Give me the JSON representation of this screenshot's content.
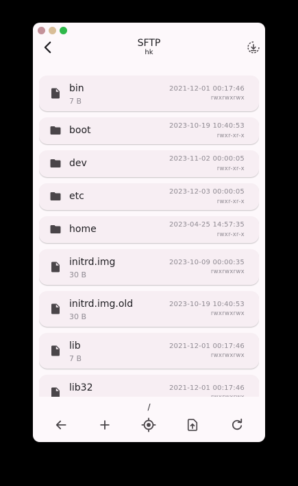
{
  "header": {
    "title": "SFTP",
    "subtitle": "hk"
  },
  "items": [
    {
      "type": "file",
      "name": "bin",
      "size": "7 B",
      "date": "2021-12-01 00:17:46",
      "perm": "rwxrwxrwx"
    },
    {
      "type": "folder",
      "name": "boot",
      "size": "",
      "date": "2023-10-19 10:40:53",
      "perm": "rwxr-xr-x"
    },
    {
      "type": "folder",
      "name": "dev",
      "size": "",
      "date": "2023-11-02 00:00:05",
      "perm": "rwxr-xr-x"
    },
    {
      "type": "folder",
      "name": "etc",
      "size": "",
      "date": "2023-12-03 00:00:05",
      "perm": "rwxr-xr-x"
    },
    {
      "type": "folder",
      "name": "home",
      "size": "",
      "date": "2023-04-25 14:57:35",
      "perm": "rwxr-xr-x"
    },
    {
      "type": "file",
      "name": "initrd.img",
      "size": "30 B",
      "date": "2023-10-09 00:00:35",
      "perm": "rwxrwxrwx"
    },
    {
      "type": "file",
      "name": "initrd.img.old",
      "size": "30 B",
      "date": "2023-10-19 10:40:53",
      "perm": "rwxrwxrwx"
    },
    {
      "type": "file",
      "name": "lib",
      "size": "7 B",
      "date": "2021-12-01 00:17:46",
      "perm": "rwxrwxrwx"
    },
    {
      "type": "file",
      "name": "lib32",
      "size": "",
      "date": "2021-12-01 00:17:46",
      "perm": "rwxrwxrwx"
    }
  ],
  "footer": {
    "path": "/"
  },
  "icons": {
    "back": "chevron-left-icon",
    "download": "download-circle-icon",
    "file": "file-icon",
    "folder": "folder-icon",
    "bottom": [
      "arrow-left-icon",
      "plus-icon",
      "gps-icon",
      "upload-file-icon",
      "refresh-icon"
    ]
  },
  "colors": {
    "background": "#fdf8fb",
    "item_bg": "#f7eef3",
    "icon": "#4a4549",
    "text": "#1c1b1f",
    "muted": "#8f8a92"
  }
}
